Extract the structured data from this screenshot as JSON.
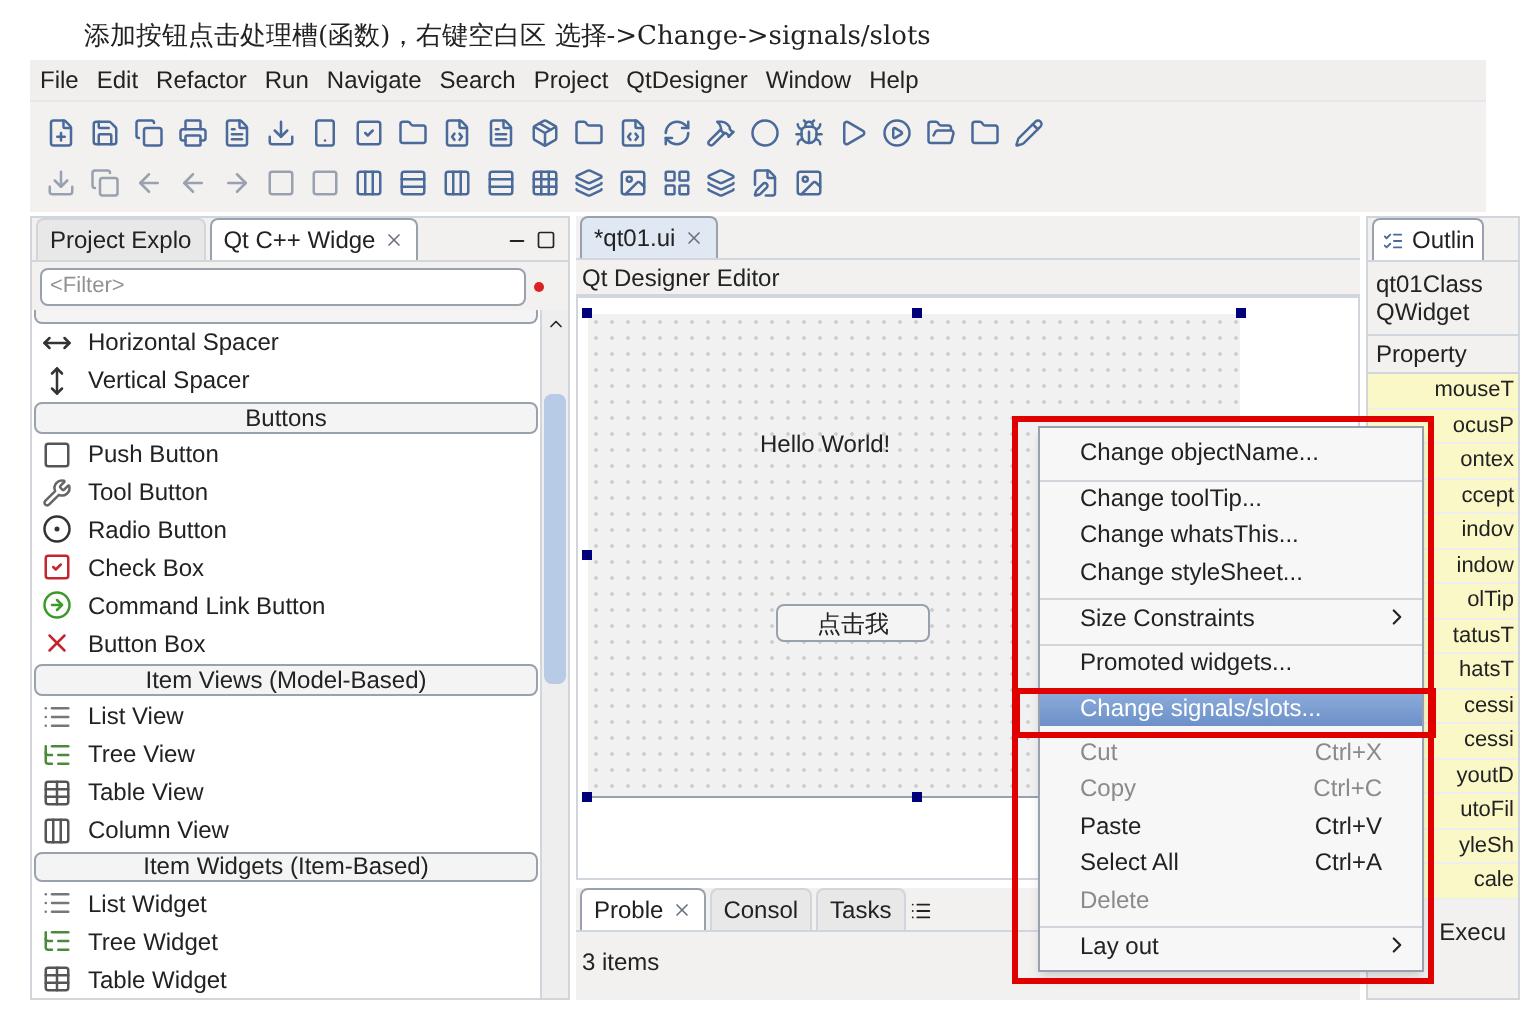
{
  "caption": "添加按钮点击处理槽(函数)，右键空白区 选择->Change->signals/slots",
  "menu_bar": [
    "File",
    "Edit",
    "Refactor",
    "Run",
    "Navigate",
    "Search",
    "Project",
    "QtDesigner",
    "Window",
    "Help"
  ],
  "left_panel": {
    "tabs": [
      {
        "label": "Project Explo",
        "selected": false
      },
      {
        "label": "Qt C++ Widge",
        "selected": true
      }
    ],
    "filter": {
      "placeholder": "<Filter>"
    },
    "items": [
      {
        "kind": "partial_header"
      },
      {
        "kind": "item",
        "label": "Horizontal Spacer"
      },
      {
        "kind": "item",
        "label": "Vertical Spacer"
      },
      {
        "kind": "header",
        "label": "Buttons"
      },
      {
        "kind": "item",
        "label": "Push Button"
      },
      {
        "kind": "item",
        "label": "Tool Button"
      },
      {
        "kind": "item",
        "label": "Radio Button"
      },
      {
        "kind": "item",
        "label": "Check Box"
      },
      {
        "kind": "item",
        "label": "Command Link Button"
      },
      {
        "kind": "item",
        "label": "Button Box"
      },
      {
        "kind": "header",
        "label": "Item Views (Model-Based)"
      },
      {
        "kind": "item",
        "label": "List View"
      },
      {
        "kind": "item",
        "label": "Tree View"
      },
      {
        "kind": "item",
        "label": "Table View"
      },
      {
        "kind": "item",
        "label": "Column View"
      },
      {
        "kind": "header",
        "label": "Item Widgets (Item-Based)"
      },
      {
        "kind": "item",
        "label": "List Widget"
      },
      {
        "kind": "item",
        "label": "Tree Widget"
      },
      {
        "kind": "item",
        "label": "Table Widget"
      }
    ]
  },
  "editor": {
    "tab": {
      "label": "*qt01.ui",
      "selected": true
    },
    "title": "Qt Designer Editor",
    "label_text": "Hello World!",
    "button_text": "点击我"
  },
  "bottom_panel": {
    "tabs": [
      {
        "label": "Proble",
        "selected": true
      },
      {
        "label": "Consol",
        "selected": false
      },
      {
        "label": "Tasks",
        "selected": false
      }
    ],
    "status": "3 items"
  },
  "outline": {
    "tab": "Outlin",
    "class_name": "qt01Class",
    "widget": "QWidget",
    "header": "Property",
    "rows": [
      "mouseT",
      "ocusP",
      "ontex",
      "ccept",
      "indov",
      "indow",
      "olTip",
      "tatusT",
      "hatsT",
      "cessi",
      "cessi",
      "youtD",
      "utoFil",
      "yleSh",
      "cale"
    ],
    "bottom_tab": "Execu"
  },
  "context_menu": [
    {
      "kind": "item",
      "label": "Change objectName...",
      "disabled": false,
      "selected": false,
      "separator_before": false
    },
    {
      "kind": "item",
      "label": "Change toolTip...",
      "disabled": false,
      "selected": false,
      "separator_before": true
    },
    {
      "kind": "item",
      "label": "Change whatsThis...",
      "disabled": false,
      "selected": false,
      "separator_before": false
    },
    {
      "kind": "item",
      "label": "Change styleSheet...",
      "disabled": false,
      "selected": false,
      "separator_before": false
    },
    {
      "kind": "submenu",
      "label": "Size Constraints",
      "disabled": false,
      "selected": false,
      "separator_before": true
    },
    {
      "kind": "item",
      "label": "Promoted widgets...",
      "disabled": false,
      "selected": false,
      "separator_before": true
    },
    {
      "kind": "item",
      "label": "Change signals/slots...",
      "disabled": false,
      "selected": true,
      "separator_before": true
    },
    {
      "kind": "item",
      "label": "Cut",
      "shortcut": "Ctrl+X",
      "disabled": true,
      "selected": false,
      "separator_before": true
    },
    {
      "kind": "item",
      "label": "Copy",
      "shortcut": "Ctrl+C",
      "disabled": true,
      "selected": false,
      "separator_before": false
    },
    {
      "kind": "item",
      "label": "Paste",
      "shortcut": "Ctrl+V",
      "disabled": false,
      "selected": false,
      "separator_before": false
    },
    {
      "kind": "item",
      "label": "Select All",
      "shortcut": "Ctrl+A",
      "disabled": false,
      "selected": false,
      "separator_before": false
    },
    {
      "kind": "item",
      "label": "Delete",
      "disabled": true,
      "selected": false,
      "separator_before": false
    },
    {
      "kind": "submenu",
      "label": "Lay out",
      "disabled": false,
      "selected": false,
      "separator_before": true
    }
  ]
}
